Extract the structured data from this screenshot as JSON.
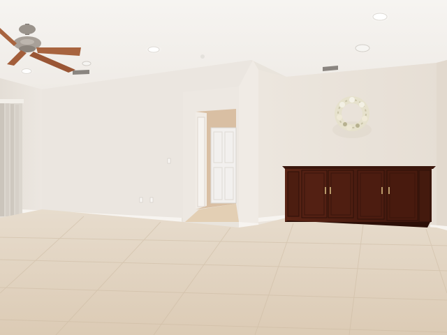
{
  "scene": {
    "description_kind": "photo",
    "colors": {
      "ceiling": "#f4f2ef",
      "wall_left": "#ece7e1",
      "wall_back": "#e8e1d9",
      "wall_right": "#ebe4dc",
      "floor": "#e3d5c2",
      "cabinet": "#4e1e12",
      "hallway": "#d9bfa3",
      "door": "#f2f0ee",
      "fan_blade": "#a8643f",
      "wreath": "#e9e4cf"
    },
    "icons": [
      "ceiling-fan-icon",
      "wreath-icon",
      "vertical-blinds-icon",
      "recessed-light-icon",
      "air-vent-icon"
    ]
  }
}
